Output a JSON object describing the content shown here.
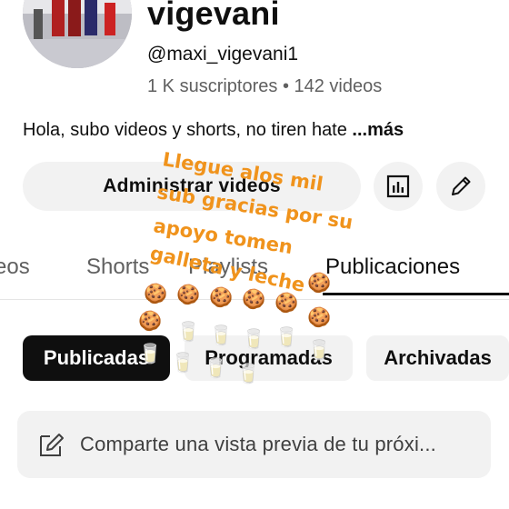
{
  "channel": {
    "name": "vigevani",
    "handle": "@maxi_vigevani1",
    "stats": "1 K suscriptores • 142 videos",
    "description": "Hola, subo videos y shorts, no tiren hate ",
    "more_label": "...más"
  },
  "actions": {
    "manage_label": "Administrar videos",
    "analytics_icon": "bar-chart-icon",
    "edit_icon": "pencil-icon"
  },
  "tabs": [
    {
      "label": "eos"
    },
    {
      "label": "Shorts"
    },
    {
      "label": "Playlists"
    },
    {
      "label": "Publicaciones",
      "active": true
    }
  ],
  "chips": [
    {
      "label": "Publicadas",
      "selected": true
    },
    {
      "label": "Programadas"
    },
    {
      "label": "Archivadas"
    }
  ],
  "composer": {
    "icon": "edit-note-icon",
    "placeholder": "Comparte una vista previa de tu próxi..."
  },
  "sticker": {
    "lines": [
      "Llegue alos mil",
      "sub gracias por su",
      "apoyo tomen",
      "galleta y leche"
    ],
    "color": "#f0931c",
    "emoji": {
      "cookie": "🍪",
      "milk": "🥛"
    }
  },
  "colors": {
    "text_primary": "#0f0f0f",
    "text_secondary": "#606060",
    "surface": "#f2f2f2",
    "accent_sticker": "#f0931c"
  }
}
